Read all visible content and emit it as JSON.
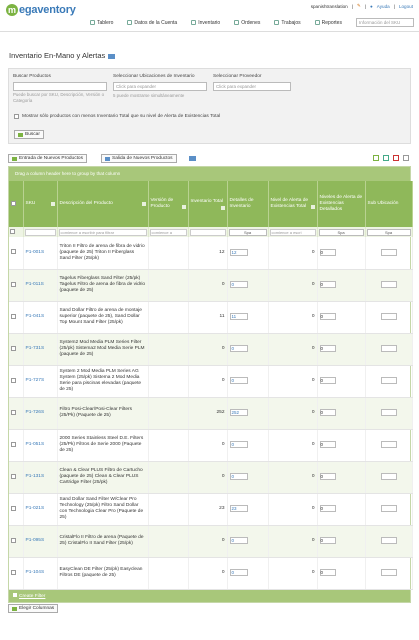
{
  "app": {
    "logo_letter": "m",
    "logo_text": "egaventory",
    "user": "spanishtranslation",
    "sep": "|",
    "help": "Ayuda",
    "logout": "Logout"
  },
  "nav": [
    {
      "label": "Tablero",
      "icon": "dashboard-icon"
    },
    {
      "label": "Datos de la Cuenta",
      "icon": "account-icon"
    },
    {
      "label": "Inventario",
      "icon": "inventory-icon"
    },
    {
      "label": "Ordenes",
      "icon": "orders-icon"
    },
    {
      "label": "Trabajos",
      "icon": "jobs-icon"
    },
    {
      "label": "Reportes",
      "icon": "reports-icon"
    }
  ],
  "search": {
    "placeholder": "Información del SKU"
  },
  "page": {
    "title": "Inventario En-Mano y Alertas"
  },
  "filters": {
    "products_label": "Buscar Productos",
    "products_hint": "Puede buscar por SKU, Descripción, Versión o Categoría",
    "locations_label": "Seleccionar Ubicaciones de Inventario",
    "locations_placeholder": "Click para expander",
    "locations_hint": "5 puede mostrarse simultáneamente",
    "provider_label": "Seleccionar Proveedor",
    "provider_placeholder": "Click para expander",
    "checkbox_label": "Mostrar sólo productos con menos Inventario Total que su nivel de Alerta de Existencias Total",
    "search_button": "Buscar"
  },
  "actions": {
    "incoming": "Entrada de Nuevos Productos",
    "outgoing": "Salida de Nuevos Productos"
  },
  "grid": {
    "group_hint": "Drag a column header here to group by that column",
    "columns": [
      "SKU",
      "Descripción del Producto",
      "Versión de Producto",
      "Inventario Total",
      "Detalles de Inventario",
      "Nivel de Alerta de Existencias Total",
      "Niveles de Alerta de Existencias Detallados",
      "Sub Ubicación"
    ],
    "filter_desc": "comience a escribir para filtrar",
    "filter_ver": "comience a",
    "filter_alert": "comience a escri",
    "spa": "Spa",
    "rows": [
      {
        "sku": "P1-001S",
        "desc": "Triton II Filtro de arena de fibra de vidrio (paquete de 25) Triton II Fiberglass Sand Filter (25/pk)",
        "total": "12",
        "detail": "12",
        "alert": "0",
        "dalert": "0"
      },
      {
        "sku": "P1-011S",
        "desc": "Tagelus Fiberglass Sand Filter (25/pk) Tagelus Filtro de arena de fibra de vidrio (paquete de 25)",
        "total": "0",
        "detail": "0",
        "alert": "0",
        "dalert": "0"
      },
      {
        "sku": "P1-041S",
        "desc": "Sand Dollar Filtro de arena de montaje superior (paquete de 25), Sand Dollar Top Mount Sand Filter (25/pk)",
        "total": "11",
        "detail": "11",
        "alert": "0",
        "dalert": "0"
      },
      {
        "sku": "P1-731S",
        "desc": "System2 Mod Media PLM Series Filter (25/pk) Sistema2 Mod Media Serie PLM (paquete de 25)",
        "total": "0",
        "detail": "0",
        "alert": "0",
        "dalert": "0"
      },
      {
        "sku": "P1-727S",
        "desc": "System 2 Mod Media PLM Series AG System (25/pk) Sistema 2 Mod Media Serie para piscinas elevadas (paquete de 25)",
        "total": "0",
        "detail": "0",
        "alert": "0",
        "dalert": "0"
      },
      {
        "sku": "P1-726S",
        "desc": "Filtro Posi-Clear/Posi-Clear Filters (25/Pk) (Paquete de 25)",
        "total": "252",
        "detail": "252",
        "alert": "0",
        "dalert": "0"
      },
      {
        "sku": "P1-051S",
        "desc": "2000 Series Stainless Steel D.E. Filters (25/Pk) Filtros de Serie 2000 (Paquete de 25)",
        "total": "0",
        "detail": "0",
        "alert": "0",
        "dalert": "0"
      },
      {
        "sku": "P1-131S",
        "desc": "Clean & Clear PLUS Filtro de Cartucho (paquete de 25) Clean & Clear PLUS Cartridge Filter (25/pk)",
        "total": "0",
        "detail": "0",
        "alert": "0",
        "dalert": "0"
      },
      {
        "sku": "P1-021S",
        "desc": "Sand Dollar Sand Filter W/Clear Pro Technology (25/pk) Filtro Sand Dollar con Technologia Clear Pro (Paquete de 25)",
        "total": "23",
        "detail": "23",
        "alert": "0",
        "dalert": "0"
      },
      {
        "sku": "P1-095S",
        "desc": "CristalFlo II Filtro de arena (Paquete de 25) CristalFlo II Sand Filter (25/pk)",
        "total": "0",
        "detail": "0",
        "alert": "0",
        "dalert": "0"
      },
      {
        "sku": "P1-104S",
        "desc": "EasyClean DE Filter (25/pk) Easyclean Filtros DE (paquete de 25)",
        "total": "0",
        "detail": "0",
        "alert": "0",
        "dalert": "0"
      }
    ],
    "create_filter": "Create Filter"
  },
  "columns_button": "Elegir Columnas"
}
